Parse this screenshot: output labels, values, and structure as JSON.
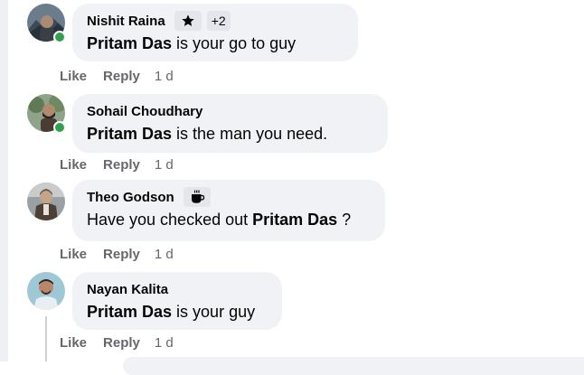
{
  "comments": [
    {
      "author": "Nishit Raina",
      "online": true,
      "badge_icon": "star-icon",
      "badge_count": "+2",
      "mention": "Pritam Das",
      "text_before": "",
      "text_after": " is your go to guy",
      "like": "Like",
      "reply": "Reply",
      "time": "1 d"
    },
    {
      "author": "Sohail Choudhary",
      "online": true,
      "mention": "Pritam Das",
      "text_before": "",
      "text_after": " is the man you need.",
      "like": "Like",
      "reply": "Reply",
      "time": "1 d"
    },
    {
      "author": "Theo Godson",
      "online": false,
      "badge_icon": "coffee-cup-icon",
      "text_before": "Have you checked out ",
      "mention": "Pritam Das",
      "text_after": " ?",
      "like": "Like",
      "reply": "Reply",
      "time": "1 d"
    },
    {
      "author": "Nayan Kalita",
      "online": false,
      "mention": "Pritam Das",
      "text_before": "",
      "text_after": " is your guy",
      "like": "Like",
      "reply": "Reply",
      "time": "1 d"
    }
  ],
  "colors": {
    "bubble": "#f0f2f5",
    "action_text": "#65676b",
    "online": "#31a24c"
  }
}
